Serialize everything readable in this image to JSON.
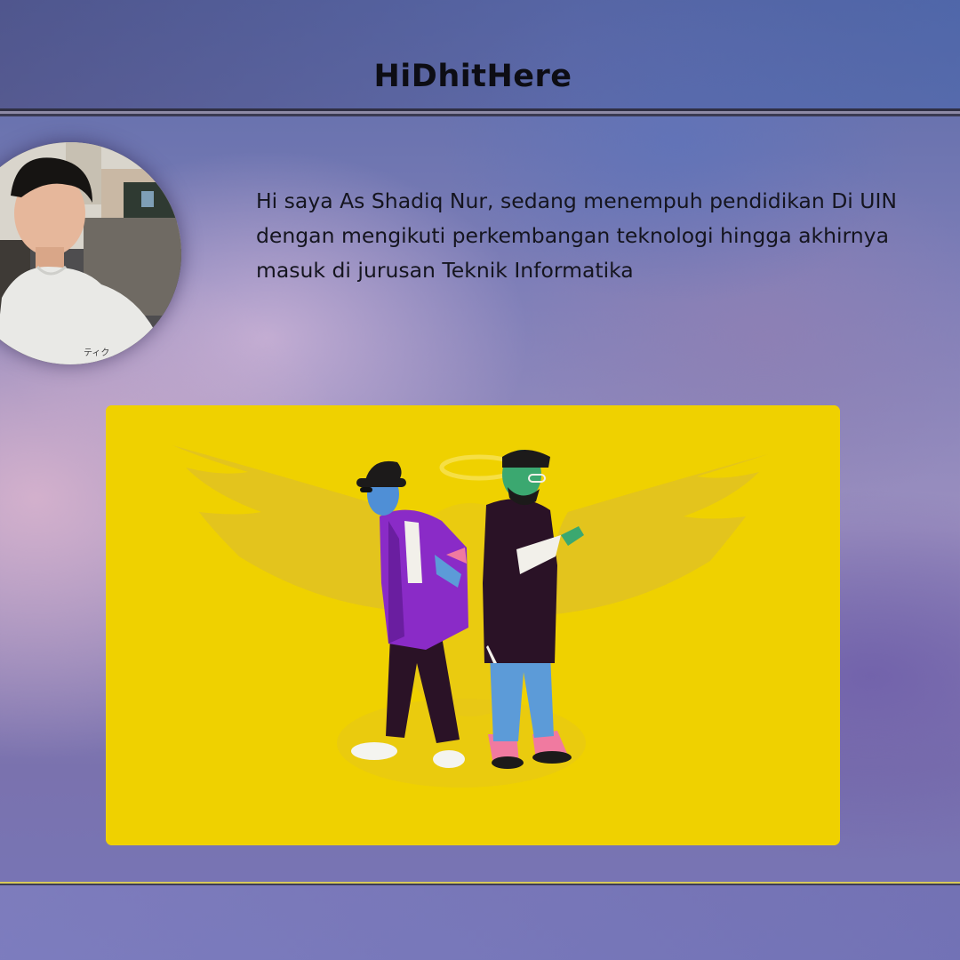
{
  "header": {
    "brand": "HiDhitHere"
  },
  "profile": {
    "avatar_alt": "profile photo",
    "bio_lines": [
      "Hi saya As Shadiq Nur, sedang menempuh pendidikan Di UIN",
      "dengan mengikuti perkembangan teknologi hingga akhirnya",
      "masuk di jurusan Teknik Informatika"
    ]
  },
  "illustration": {
    "alt": "two cartoon men standing back to back in front of angel wings on a yellow background",
    "background_color": "#efd100"
  },
  "colors": {
    "header_rule": "#2f2f44",
    "footer_rule": "#d7c95a",
    "text": "#15151f"
  }
}
